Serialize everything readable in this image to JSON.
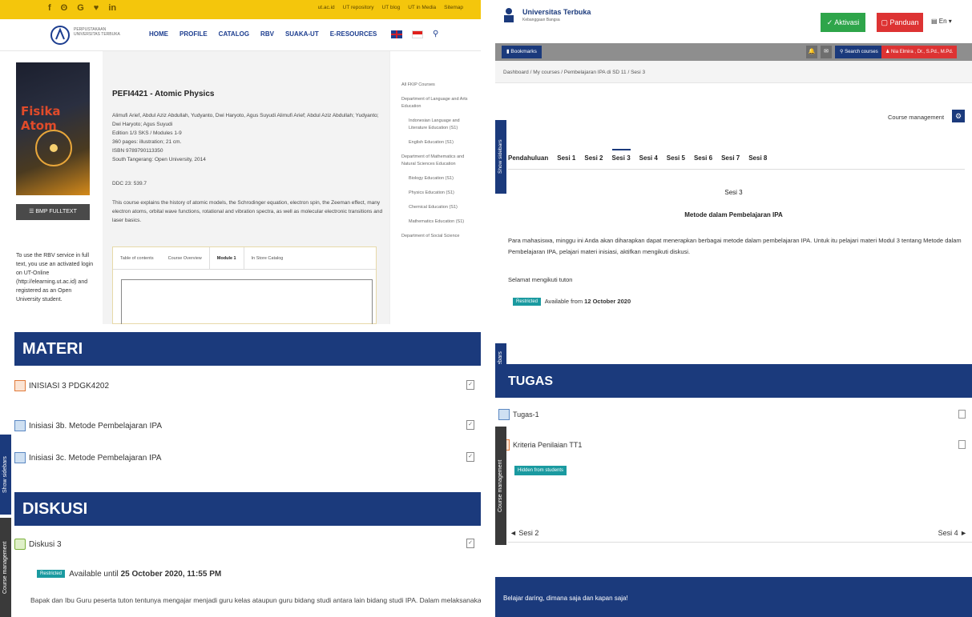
{
  "library": {
    "social": [
      "f",
      "ʘ",
      "G",
      "♥",
      "in"
    ],
    "top_links": [
      "ut.ac.id",
      "UT repository",
      "UT blog",
      "UT in Media",
      "Sitemap"
    ],
    "logo_text": "PERPUSTAKAAN UNIVERSITAS TERBUKA",
    "menu": [
      "HOME",
      "PROFILE",
      "CATALOG",
      "RBV",
      "SUAKA-UT",
      "E-RESOURCES"
    ],
    "book_cover_title": "Fisika Atom",
    "fulltext_button": "BMP FULLTEXT",
    "left_note": "To use the RBV service in full text, you use an activated login on UT-Online (http://elearning.ut.ac.id) and registered as an Open University student.",
    "course_title": "PEFI4421 - Atomic Physics",
    "authors": "Alimufi Arief, Abdul Aziz Abdullah, Yudyanto, Dwi Haryoto, Agus Suyudi Alimufi Arief; Abdul Aziz Abdullah; Yudyanto; Dwi Haryoto; Agus Suyudi",
    "edition": "Edition 1/3 SKS / Modules 1-9",
    "pages": "360 pages: illustration; 21 cm.",
    "isbn": "ISBN 9789790113350",
    "publisher": "South Tangerang: Open University, 2014",
    "ddc": "DDC 23: 539.7",
    "description": "This course explains the history of atomic models, the Schrodinger equation, electron spin, the Zeeman effect, many electron atoms, orbital wave functions, rotational and vibration spectra, as well as molecular electronic transitions and laser basics.",
    "tabs": [
      "Table of contents",
      "Course Overview",
      "Module 1",
      "In Store Catalog"
    ],
    "active_tab": "Module 1",
    "sidebar": [
      {
        "label": "All FKIP Courses",
        "sub": false
      },
      {
        "label": "Department of Language and Arts Education",
        "sub": false
      },
      {
        "label": "Indonesian Language and Literature Education (S1)",
        "sub": true
      },
      {
        "label": "English Education (S1)",
        "sub": true
      },
      {
        "label": "Department of Mathematics and Natural Sciences Education",
        "sub": false
      },
      {
        "label": "Biology Education (S1)",
        "sub": true
      },
      {
        "label": "Physics Education (S1)",
        "sub": true
      },
      {
        "label": "Chemical Education (S1)",
        "sub": true
      },
      {
        "label": "Mathematics Education (S1)",
        "sub": true
      },
      {
        "label": "Department of Social Science",
        "sub": false
      }
    ]
  },
  "course": {
    "university": "Universitas Terbuka",
    "university_sub": "Kebanggaan Bangsa",
    "aktivasi": "Aktivasi",
    "panduan": "Panduan",
    "lang": "En",
    "bookmarks": "Bookmarks",
    "search_courses": "Search courses",
    "user": "Nia Elmira , Dr., S.Pd., M.Pd.",
    "breadcrumb": "Dashboard / My courses / Pembelajaran IPA di SD 11 / Sesi 3",
    "show_sidebars": "Show sidebars",
    "course_management": "Course management",
    "tabs": [
      "Pendahuluan",
      "Sesi 1",
      "Sesi 2",
      "Sesi 3",
      "Sesi 4",
      "Sesi 5",
      "Sesi 6",
      "Sesi 7",
      "Sesi 8"
    ],
    "active_tab": "Sesi 3",
    "sesi_title": "Sesi 3",
    "metode_title": "Metode dalam Pembelajaran IPA",
    "paragraph": "Para mahasiswa, minggu ini Anda akan diharapkan dapat menerapkan berbagai metode dalam pembelajaran IPA. Untuk itu pelajari materi Modul 3 tentang Metode dalam Pembelajaran IPA, pelajari materi inisiasi, aktifkan mengikuti diskusi.",
    "selamat": "Selamat mengikuti tuton",
    "restricted_badge": "Restricted",
    "available_from": "Available from",
    "available_date": "12 October 2020"
  },
  "materi": {
    "section_title": "MATERI",
    "items": [
      "INISIASI 3 PDGK4202",
      "Inisiasi 3b. Metode Pembelajaran IPA",
      "Inisiasi 3c. Metode Pembelajaran IPA"
    ],
    "diskusi_title": "DISKUSI",
    "diskusi_item": "Diskusi 3",
    "restricted_badge": "Restricted",
    "available_until": "Available until",
    "available_until_date": "25 October 2020, 11:55 PM",
    "paragraph": "Bapak dan Ibu Guru peserta tuton tentunya mengajar menjadi guru kelas ataupun guru bidang studi antara lain bidang studi IPA. Dalam melaksanakan pembelajaran",
    "show_sidebars": "Show sidebars",
    "course_management": "Course management"
  },
  "tugas": {
    "section_title": "TUGAS",
    "items": [
      "Tugas-1",
      "Kriteria Penilaian TT1"
    ],
    "hidden_badge": "Hidden from students",
    "prev": "◄ Sesi 2",
    "next": "Sesi 4 ►",
    "footer": "Belajar daring, dimana saja dan kapan saja!",
    "show_sidebars": "Show sidebars",
    "course_management": "Course management"
  },
  "colors": {
    "brand_blue": "#1b3a7c",
    "yellow": "#f4c60c",
    "green": "#2ea54a",
    "red": "#dd3333",
    "teal": "#1a9aa0"
  }
}
